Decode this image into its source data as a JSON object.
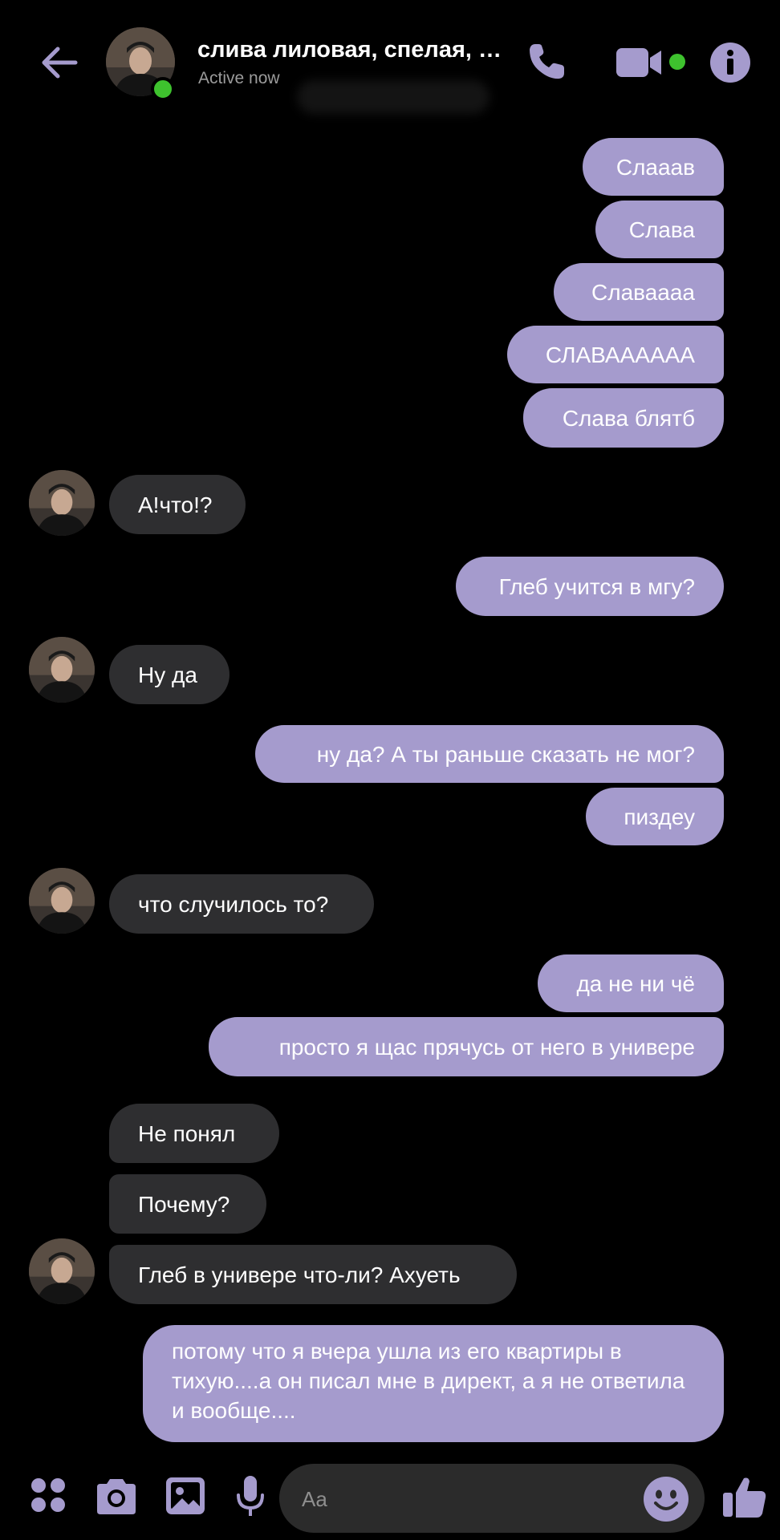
{
  "header": {
    "contact_name": "слива лиловая, спелая, с...",
    "status": "Active now"
  },
  "colors": {
    "accent": "#a59bcd",
    "incoming_bubble": "#2e2e30",
    "online": "#3ec22e",
    "background": "#000000"
  },
  "messages": [
    {
      "dir": "out",
      "text": "Слааав"
    },
    {
      "dir": "out",
      "text": "Слава"
    },
    {
      "dir": "out",
      "text": "Славаааа"
    },
    {
      "dir": "out",
      "text": "СЛАВААААAA"
    },
    {
      "dir": "out",
      "text": "Слава блятб"
    },
    {
      "dir": "in",
      "text": "А!что!?"
    },
    {
      "dir": "out",
      "text": "Глеб учится в мгу?"
    },
    {
      "dir": "in",
      "text": "Ну да"
    },
    {
      "dir": "out",
      "text": "ну да? А ты раньше сказать не мог?"
    },
    {
      "dir": "out",
      "text": "пиздеу"
    },
    {
      "dir": "in",
      "text": "что случилось то?"
    },
    {
      "dir": "out",
      "text": "да не ни чё"
    },
    {
      "dir": "out",
      "text": "просто я щас прячусь от него в универе"
    },
    {
      "dir": "in",
      "text": "Не понял"
    },
    {
      "dir": "in",
      "text": "Почему?"
    },
    {
      "dir": "in",
      "text": "Глеб в универе что-ли? Ахуеть"
    },
    {
      "dir": "out",
      "text": "потому что я вчера ушла из его квартиры в тихую....а он писал мне в директ, а я не ответила и вообще...."
    }
  ],
  "composer": {
    "placeholder": "Aa"
  },
  "icons": {
    "back": "arrow-left-icon",
    "call": "phone-icon",
    "video": "video-camera-icon",
    "info": "info-icon",
    "menu": "four-dots-icon",
    "camera": "camera-icon",
    "gallery": "image-icon",
    "mic": "microphone-icon",
    "emoji": "smiley-icon",
    "like": "thumbs-up-icon"
  }
}
